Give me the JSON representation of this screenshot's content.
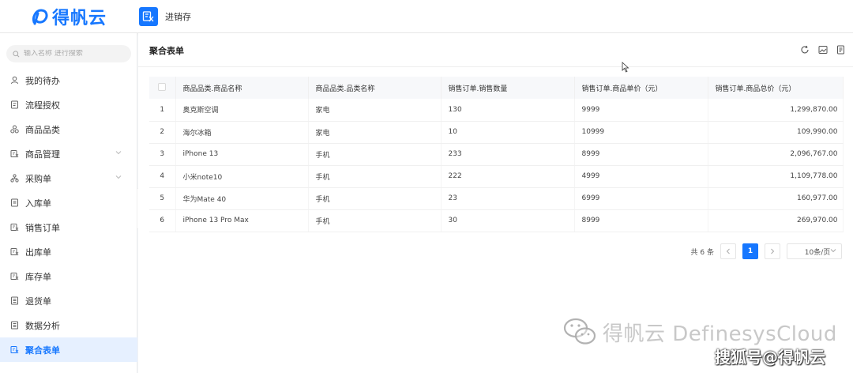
{
  "brand": {
    "logo_text": "得帆云"
  },
  "app": {
    "name": "进销存"
  },
  "sidebar": {
    "search_placeholder": "输入名称 进行搜索",
    "items": [
      {
        "label": "我的待办",
        "icon": "user-icon"
      },
      {
        "label": "流程授权",
        "icon": "form-icon"
      },
      {
        "label": "商品品类",
        "icon": "category-icon"
      },
      {
        "label": "商品管理",
        "icon": "grid-icon",
        "expandable": true
      },
      {
        "label": "采购单",
        "icon": "tree-icon",
        "expandable": true
      },
      {
        "label": "入库单",
        "icon": "doc-icon"
      },
      {
        "label": "销售订单",
        "icon": "grid-icon"
      },
      {
        "label": "出库单",
        "icon": "grid-icon"
      },
      {
        "label": "库存单",
        "icon": "grid-icon"
      },
      {
        "label": "退货单",
        "icon": "list-icon"
      },
      {
        "label": "数据分析",
        "icon": "list-icon"
      },
      {
        "label": "聚合表单",
        "icon": "grid-icon",
        "active": true
      }
    ]
  },
  "main": {
    "title": "聚合表单",
    "table": {
      "columns": [
        "商品品类.商品名称",
        "商品品类.品类名称",
        "销售订单.销售数量",
        "销售订单.商品单价（元）",
        "销售订单.商品总价（元）"
      ],
      "rows": [
        {
          "idx": "1",
          "name": "奥克斯空调",
          "category": "家电",
          "qty": "130",
          "price": "9999",
          "total": "1,299,870.00"
        },
        {
          "idx": "2",
          "name": "海尔冰箱",
          "category": "家电",
          "qty": "10",
          "price": "10999",
          "total": "109,990.00"
        },
        {
          "idx": "3",
          "name": "iPhone 13",
          "category": "手机",
          "qty": "233",
          "price": "8999",
          "total": "2,096,767.00"
        },
        {
          "idx": "4",
          "name": "小米note10",
          "category": "手机",
          "qty": "222",
          "price": "4999",
          "total": "1,109,778.00"
        },
        {
          "idx": "5",
          "name": "华为Mate 40",
          "category": "手机",
          "qty": "23",
          "price": "6999",
          "total": "160,977.00"
        },
        {
          "idx": "6",
          "name": "iPhone 13 Pro Max",
          "category": "手机",
          "qty": "30",
          "price": "8999",
          "total": "269,970.00"
        }
      ]
    },
    "pagination": {
      "total_text": "共 6 条",
      "current_page": "1",
      "page_size": "10条/页"
    }
  },
  "watermark": {
    "line1": "得帆云 DefinesysCloud",
    "line2": "搜狐号@得帆云"
  },
  "colors": {
    "accent": "#1677ff"
  }
}
